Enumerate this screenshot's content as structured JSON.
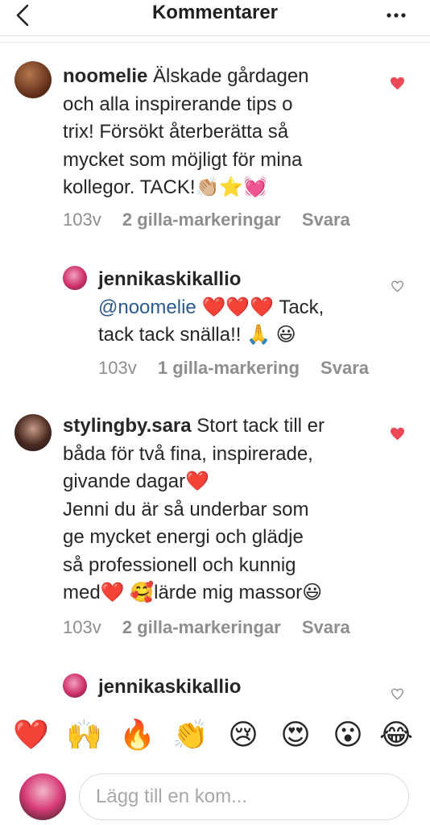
{
  "header": {
    "title": "Kommentarer"
  },
  "comments": [
    {
      "username": "noomelie",
      "text_lines": [
        "Älskade gårdagen",
        "och alla inspirerande tips o",
        "trix! Försökt återberätta så",
        "mycket som möjligt för mina",
        "kollegor. TACK!👏🏼⭐💓"
      ],
      "time": "103v",
      "likes": "2 gilla-markeringar",
      "reply": "Svara",
      "liked": true
    },
    {
      "username": "jennikaskikallio",
      "mention": "@noomelie",
      "text_lines": [
        "❤️❤️❤️ Tack,",
        "tack tack snälla!! 🙏 😃"
      ],
      "time": "103v",
      "likes": "1 gilla-markering",
      "reply": "Svara",
      "liked": false
    },
    {
      "username": "stylingby.sara",
      "text_lines": [
        "Stort tack till er",
        "båda för två fina, inspirerade,",
        "givande dagar❤️",
        "Jenni du är så underbar som",
        "ge mycket energi och glädje",
        "så professionell och kunnig",
        "med❤️ 🥰lärde mig massor😃"
      ],
      "time": "103v",
      "likes": "2 gilla-markeringar",
      "reply": "Svara",
      "liked": true
    },
    {
      "username": "jennikaskikallio",
      "liked": false
    }
  ],
  "emoji_bar": [
    "❤️",
    "🙌",
    "🔥",
    "👏",
    "😢",
    "😍",
    "😮",
    "😂"
  ],
  "composer": {
    "placeholder": "Lägg till en kom..."
  },
  "colors": {
    "like_red": "#ed4956",
    "mention_blue": "#2b5a8f",
    "meta_gray": "#8e8e8e"
  }
}
